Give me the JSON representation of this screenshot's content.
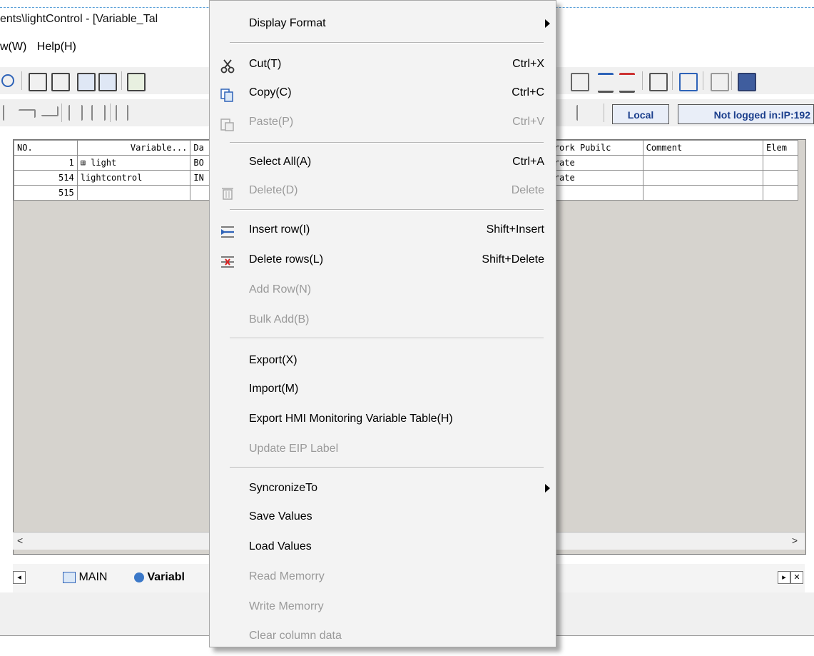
{
  "window": {
    "title": "ents\\lightControl - [Variable_Tal",
    "menus": [
      "w(W)",
      "Help(H)"
    ]
  },
  "toolbar": {
    "local_label": "Local",
    "login_status": "Not logged in:IP:192"
  },
  "table": {
    "headers": [
      "NO.",
      "Variable...",
      "Da",
      "",
      "rork Pubilc",
      "Comment",
      "Elem"
    ],
    "rows": [
      {
        "no": "1",
        "variable": "⊞ light",
        "type": "BO",
        "public": "rate"
      },
      {
        "no": "514",
        "variable": "lightcontrol",
        "type": "IN",
        "public": "rate"
      },
      {
        "no": "515",
        "variable": "",
        "type": "",
        "public": ""
      }
    ]
  },
  "tabs": {
    "main": "MAIN",
    "variable": "Variabl"
  },
  "context_menu": {
    "items": [
      {
        "label": "Display Format",
        "shortcut": "",
        "submenu": true,
        "disabled": false,
        "icon": ""
      },
      {
        "label": "Cut(T)",
        "shortcut": "Ctrl+X",
        "disabled": false,
        "icon": "scissors-icon"
      },
      {
        "label": "Copy(C)",
        "shortcut": "Ctrl+C",
        "disabled": false,
        "icon": "copy-icon"
      },
      {
        "label": "Paste(P)",
        "shortcut": "Ctrl+V",
        "disabled": true,
        "icon": "paste-icon"
      },
      {
        "label": "Select All(A)",
        "shortcut": "Ctrl+A",
        "disabled": false,
        "icon": ""
      },
      {
        "label": "Delete(D)",
        "shortcut": "Delete",
        "disabled": true,
        "icon": "trash-icon"
      },
      {
        "label": "Insert row(I)",
        "shortcut": "Shift+Insert",
        "disabled": false,
        "icon": "insert-row-icon"
      },
      {
        "label": "Delete rows(L)",
        "shortcut": "Shift+Delete",
        "disabled": false,
        "icon": "delete-row-icon"
      },
      {
        "label": "Add Row(N)",
        "shortcut": "",
        "disabled": true,
        "icon": ""
      },
      {
        "label": "Bulk Add(B)",
        "shortcut": "",
        "disabled": true,
        "icon": ""
      },
      {
        "label": "Export(X)",
        "shortcut": "",
        "disabled": false,
        "icon": ""
      },
      {
        "label": "Import(M)",
        "shortcut": "",
        "disabled": false,
        "icon": ""
      },
      {
        "label": "Export HMI Monitoring Variable Table(H)",
        "shortcut": "",
        "disabled": false,
        "icon": ""
      },
      {
        "label": "Update EIP Label",
        "shortcut": "",
        "disabled": true,
        "icon": ""
      },
      {
        "label": "SyncronizeTo",
        "shortcut": "",
        "submenu": true,
        "disabled": false,
        "icon": ""
      },
      {
        "label": "Save Values",
        "shortcut": "",
        "disabled": false,
        "icon": ""
      },
      {
        "label": "Load Values",
        "shortcut": "",
        "disabled": false,
        "icon": ""
      },
      {
        "label": "Read Memorry",
        "shortcut": "",
        "disabled": true,
        "icon": ""
      },
      {
        "label": "Write Memorry",
        "shortcut": "",
        "disabled": true,
        "icon": ""
      },
      {
        "label": "Clear column data",
        "shortcut": "",
        "disabled": true,
        "icon": ""
      }
    ]
  },
  "colors": {
    "menu_bg": "#f3f3f3",
    "disabled_text": "#9a9a9a",
    "table_bg": "#d6d3ce",
    "accent_blue": "#1a3e8c"
  }
}
